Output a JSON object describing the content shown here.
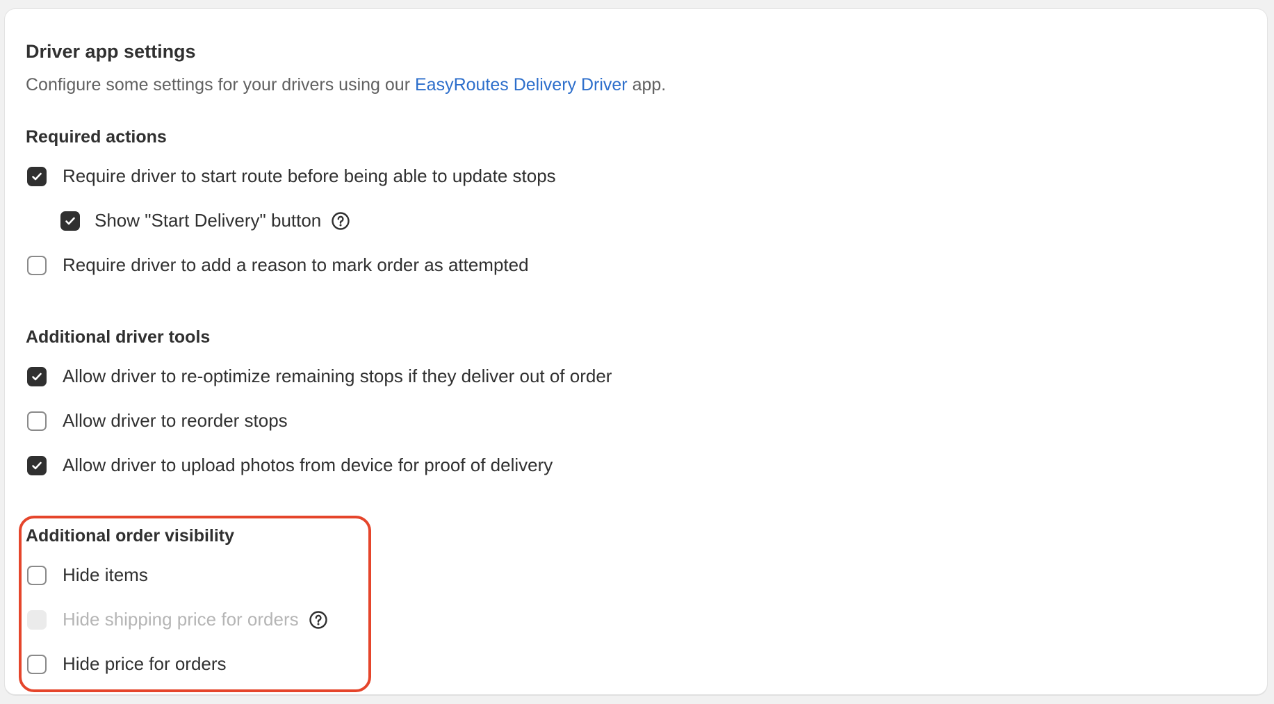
{
  "card": {
    "title": "Driver app settings",
    "description_prefix": "Configure some settings for your drivers using our ",
    "description_link": "EasyRoutes Delivery Driver",
    "description_suffix": " app."
  },
  "required_actions": {
    "title": "Required actions",
    "options": [
      {
        "label": "Require driver to start route before being able to update stops",
        "checked": true
      },
      {
        "label": "Show \"Start Delivery\" button",
        "checked": true,
        "has_help_icon": true
      },
      {
        "label": "Require driver to add a reason to mark order as attempted",
        "checked": false
      }
    ]
  },
  "additional_driver_tools": {
    "title": "Additional driver tools",
    "options": [
      {
        "label": "Allow driver to re-optimize remaining stops if they deliver out of order",
        "checked": true
      },
      {
        "label": "Allow driver to reorder stops",
        "checked": false
      },
      {
        "label": "Allow driver to upload photos from device for proof of delivery",
        "checked": true
      }
    ]
  },
  "additional_order_visibility": {
    "title": "Additional order visibility",
    "options": [
      {
        "label": "Hide items",
        "checked": false
      },
      {
        "label": "Hide shipping price for orders",
        "checked": false,
        "disabled": true,
        "has_help_icon": true
      },
      {
        "label": "Hide price for orders",
        "checked": false
      }
    ]
  },
  "colors": {
    "link": "#2c6ecb",
    "checked_box": "#303030",
    "highlight_border": "#e5452b"
  },
  "icons": {
    "checkmark": "checkmark-icon",
    "help": "question-circle-icon"
  }
}
